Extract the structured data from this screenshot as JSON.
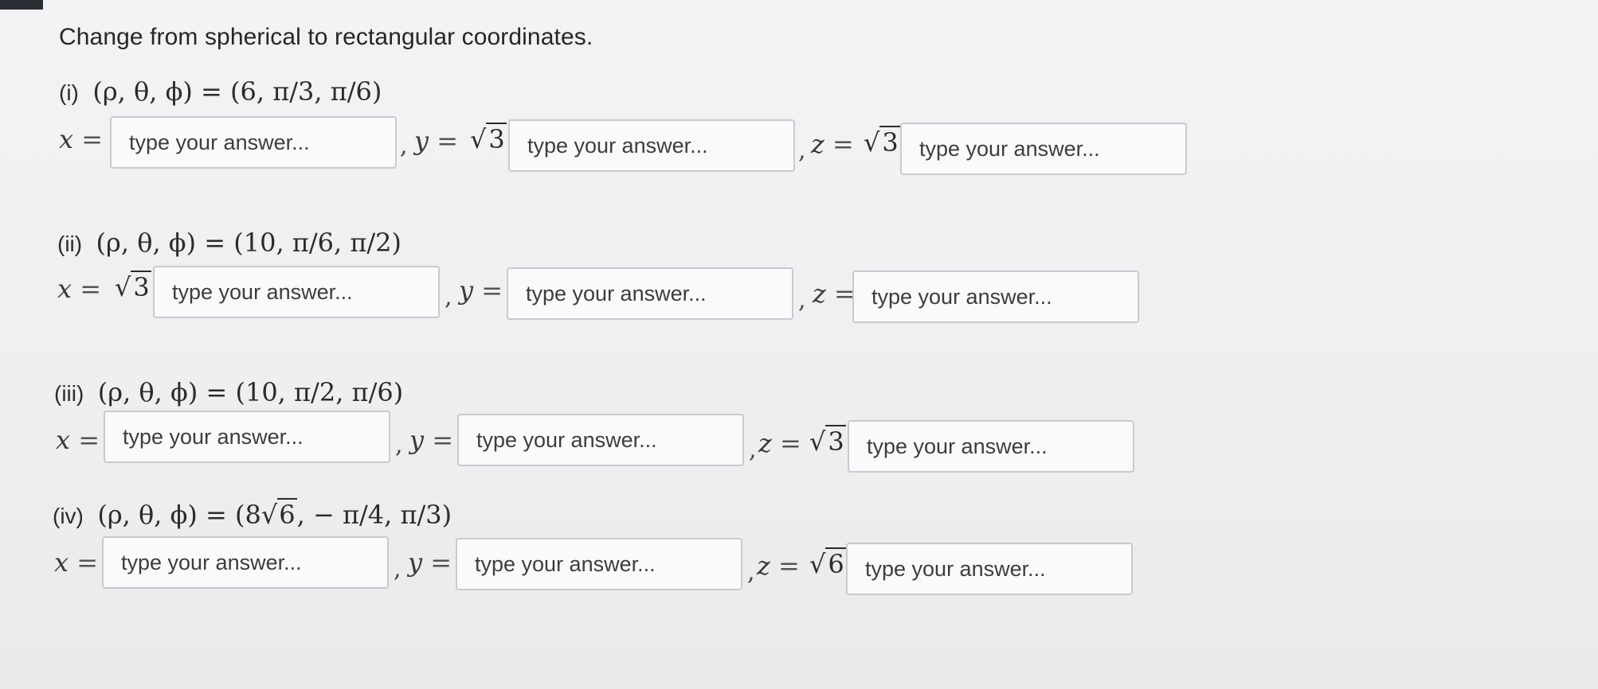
{
  "question": {
    "title": "Change from spherical to rectangular coordinates."
  },
  "parts": [
    {
      "label": "(i)",
      "tuple": "(ρ, θ, ϕ) = (6, π/3, π/6)",
      "x_prefix": "",
      "y_prefix": "3",
      "z_prefix": "3",
      "placeholder": "type your answer..."
    },
    {
      "label": "(ii)",
      "tuple": "(ρ, θ, ϕ) = (10, π/6, π/2)",
      "x_prefix": "3",
      "y_prefix": "",
      "z_prefix": "",
      "placeholder": "type your answer..."
    },
    {
      "label": "(iii)",
      "tuple": "(ρ, θ, ϕ) = (10, π/2, π/6)",
      "x_prefix": "",
      "y_prefix": "",
      "z_prefix": "3",
      "placeholder": "type your answer..."
    },
    {
      "label": "(iv)",
      "tuple_start": "(ρ, θ, ϕ) = (8",
      "tuple_radicand": "6",
      "tuple_end": ",  − π/4,  π/3)",
      "x_prefix": "",
      "y_prefix": "",
      "z_prefix": "6",
      "placeholder": "type your answer..."
    }
  ],
  "symbols": {
    "x": "x",
    "y": "y",
    "z": "z",
    "equals": "=",
    "comma": ",",
    "sqrt": "√"
  }
}
